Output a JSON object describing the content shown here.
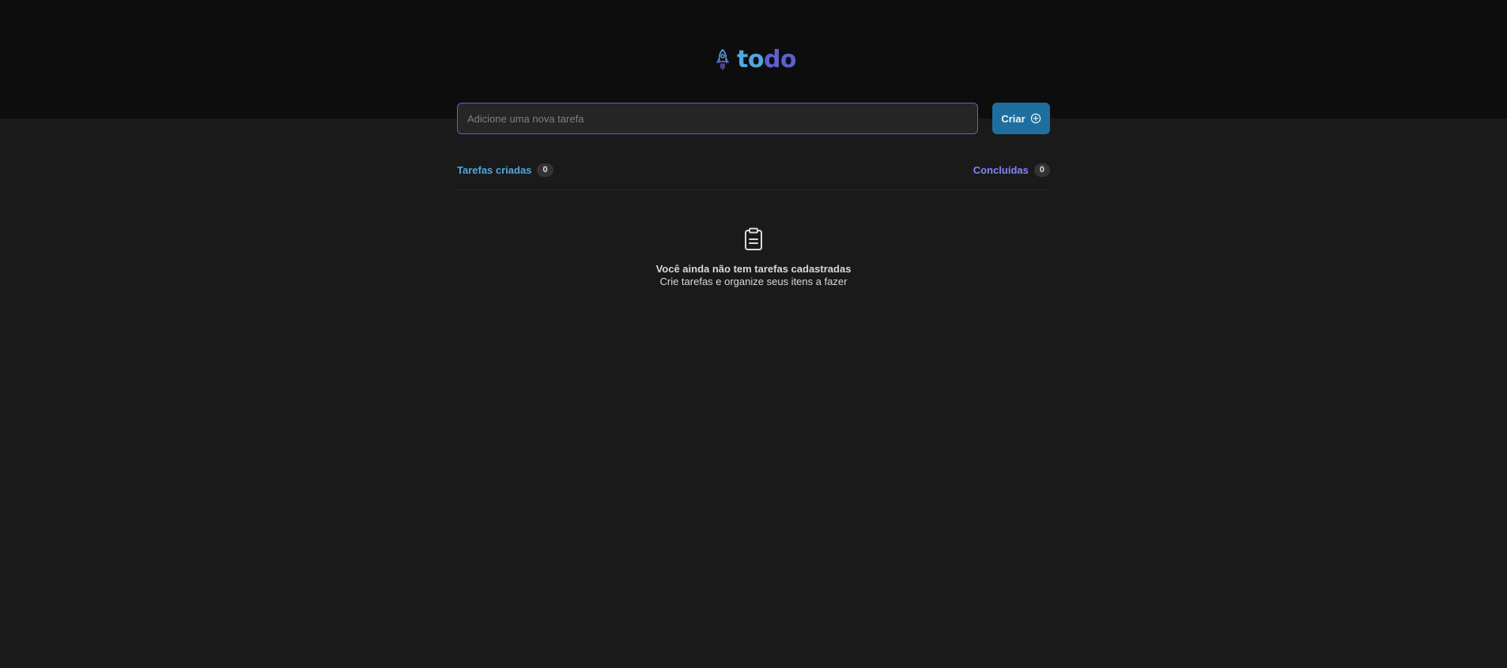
{
  "header": {
    "logo_icon": "rocket-icon",
    "logo_part_a": "to",
    "logo_part_b": "do"
  },
  "new_task": {
    "placeholder": "Adicione uma nova tarefa",
    "value": "",
    "create_label": "Criar",
    "create_icon": "plus-circle-icon"
  },
  "counters": {
    "created_label": "Tarefas criadas",
    "created_count": "0",
    "done_label": "Concluídas",
    "done_count": "0"
  },
  "empty_state": {
    "icon": "clipboard-icon",
    "title": "Você ainda não tem tarefas cadastradas",
    "subtitle": "Crie tarefas e organize seus itens a fazer"
  },
  "colors": {
    "blue": "#4ea8de",
    "purple": "#5e60ce",
    "button": "#1e6f9f",
    "header_bg": "#0d0d0d",
    "page_bg": "#1a1a1a"
  }
}
